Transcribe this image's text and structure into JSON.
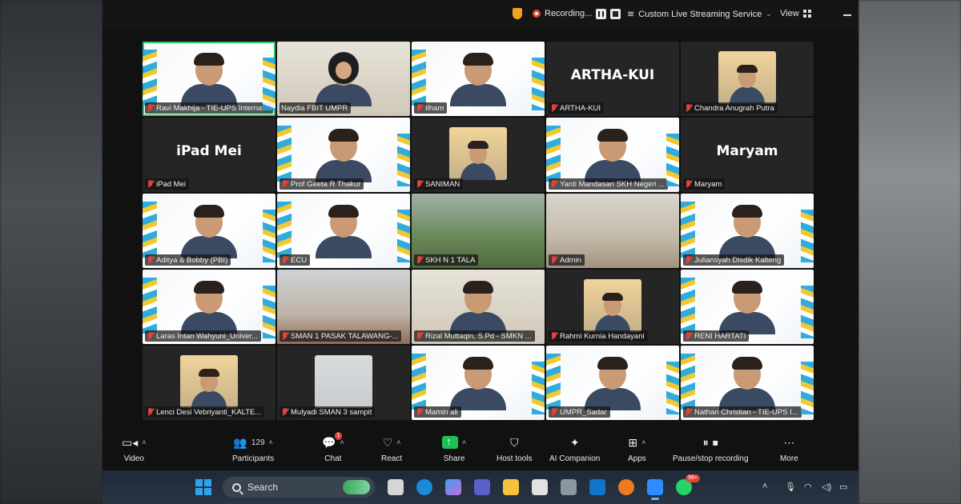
{
  "topbar": {
    "recording_label": "Recording...",
    "streaming_label": "Custom Live Streaming Service",
    "view_label": "View"
  },
  "participants": [
    {
      "name": "Ravi Makhija - TIE-UPS Internat...",
      "type": "slide",
      "active": true,
      "muted": true
    },
    {
      "name": "Naydia FBIT UMPR",
      "type": "cam",
      "active": false,
      "muted": false
    },
    {
      "name": "Ilham",
      "type": "slide",
      "active": false,
      "muted": true
    },
    {
      "name": "ARTHA-KUI",
      "avatar_text": "ARTHA-KUI",
      "type": "dark",
      "active": false,
      "muted": true
    },
    {
      "name": "Chandra Anugrah Putra",
      "type": "dark-thumb",
      "active": false,
      "muted": true
    },
    {
      "name": "iPad Mei",
      "avatar_text": "iPad Mei",
      "type": "dark",
      "active": false,
      "muted": true
    },
    {
      "name": "Prof Geeta R Thakur",
      "type": "slide",
      "active": false,
      "muted": true
    },
    {
      "name": "SANIMAN",
      "type": "dark-cam",
      "active": false,
      "muted": true
    },
    {
      "name": "Yanti Mandasari SKH Negeri ...",
      "type": "slide",
      "active": false,
      "muted": true
    },
    {
      "name": "Maryam",
      "avatar_text": "Maryam",
      "type": "dark",
      "active": false,
      "muted": true
    },
    {
      "name": "Aditya & Bobby (PBI)",
      "type": "slide",
      "active": false,
      "muted": true
    },
    {
      "name": "ECU",
      "type": "slide",
      "active": false,
      "muted": true
    },
    {
      "name": "SKH N 1 TALA",
      "type": "photo",
      "active": false,
      "muted": true
    },
    {
      "name": "Admin",
      "type": "class",
      "active": false,
      "muted": true
    },
    {
      "name": "Juliansyah Disdik Kalteng",
      "type": "slide",
      "active": false,
      "muted": true
    },
    {
      "name": "Laras Intan Wahyuni_Univer...",
      "type": "slide",
      "active": false,
      "muted": true
    },
    {
      "name": "SMAN 1 PASAK TALAWANG-...",
      "type": "room",
      "active": false,
      "muted": true
    },
    {
      "name": "Rizal Muttaqin, S.Pd - SMKN ...",
      "type": "cam",
      "active": false,
      "muted": true
    },
    {
      "name": "Rahmi Kurnia Handayani",
      "type": "dark-cam",
      "active": false,
      "muted": true
    },
    {
      "name": "RENI HARTATI",
      "type": "slide",
      "active": false,
      "muted": true
    },
    {
      "name": "Lenci Desi Vebriyanti_KALTE...",
      "type": "dark-cam",
      "active": false,
      "muted": true
    },
    {
      "name": "Mulyadi SMAN 3 sampit",
      "type": "dark-wall",
      "active": false,
      "muted": true
    },
    {
      "name": "Mamin ali",
      "type": "slide",
      "active": false,
      "muted": true
    },
    {
      "name": "UMPR_Sadar",
      "type": "slide",
      "active": false,
      "muted": true
    },
    {
      "name": "Nathan Christian - TIE-UPS I...",
      "type": "slide",
      "active": false,
      "muted": true
    }
  ],
  "toolbar": {
    "video": "Video",
    "participants": "Participants",
    "participants_count": "129",
    "chat": "Chat",
    "chat_badge": "1",
    "react": "React",
    "share": "Share",
    "host_tools": "Host tools",
    "ai_companion": "AI Companion",
    "apps": "Apps",
    "recording": "Pause/stop recording",
    "more": "More"
  },
  "taskbar": {
    "search_placeholder": "Search",
    "whatsapp_badge": "99+"
  },
  "colors": {
    "active_speaker": "#31c46a",
    "share_green": "#1fbf5a",
    "muted_red": "#e0433a",
    "recording_red": "#e5453a"
  }
}
